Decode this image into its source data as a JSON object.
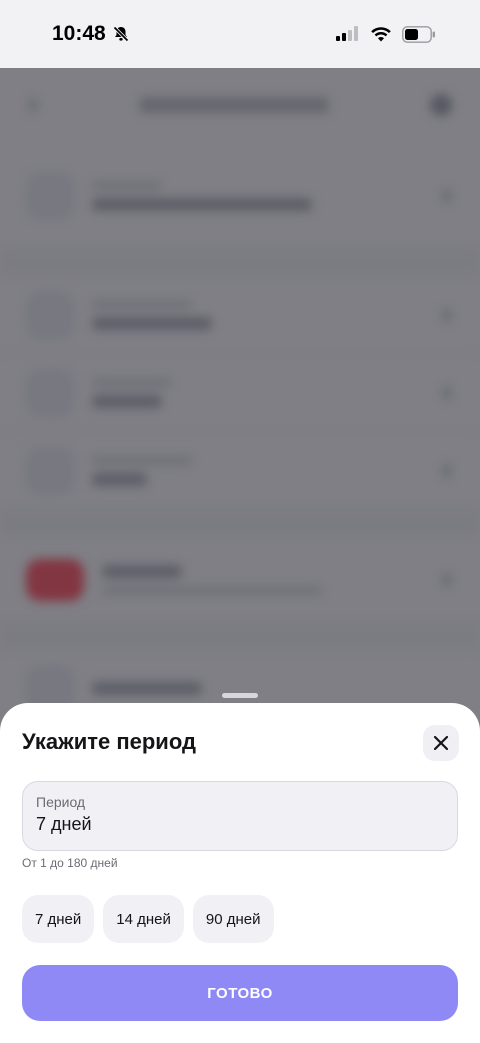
{
  "status_bar": {
    "time": "10:48"
  },
  "sheet": {
    "title": "Укажите период",
    "field_label": "Период",
    "field_value": "7 дней",
    "hint": "От 1 до 180 дней",
    "chips": [
      "7 дней",
      "14 дней",
      "90 дней"
    ],
    "done_label": "ГОТОВО"
  },
  "colors": {
    "accent": "#8f89f5",
    "overlay": "#4a4a52",
    "sheet_bg": "#ffffff",
    "field_bg": "#f1f1f5"
  },
  "icons": [
    "bell-slash-icon",
    "signal-icon",
    "wifi-icon",
    "battery-icon",
    "close-icon"
  ]
}
